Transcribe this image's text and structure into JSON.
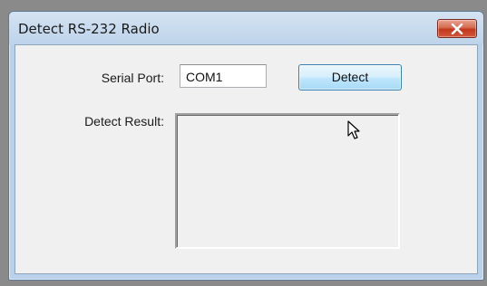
{
  "window": {
    "title": "Detect RS-232 Radio",
    "close_icon": "close-x-icon"
  },
  "form": {
    "serial_port_label": "Serial Port:",
    "serial_port_value": "COM1",
    "detect_button_label": "Detect",
    "detect_result_label": "Detect Result:",
    "detect_result_value": ""
  },
  "cursor": "arrow-pointer-icon",
  "colors": {
    "close_button": "#c8452a",
    "title_bar": "#c6d9ee",
    "detect_button_hover": "#bee6fd"
  }
}
